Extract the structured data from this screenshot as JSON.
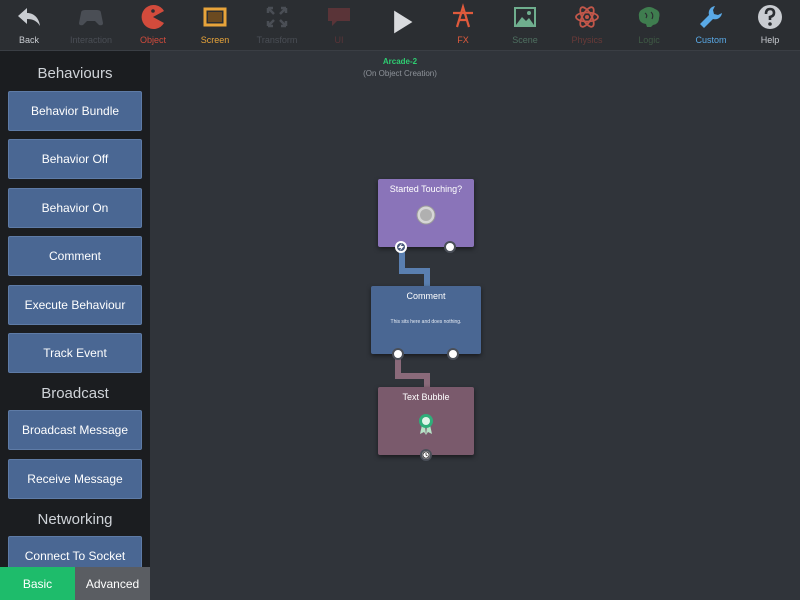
{
  "toolbar": {
    "items": [
      {
        "label": "Back",
        "icon": "back-arrow-icon",
        "color": "#c9ccd1"
      },
      {
        "label": "Interaction",
        "icon": "gamepad-icon",
        "color": "#4a4e55"
      },
      {
        "label": "Object",
        "icon": "pacman-icon",
        "color": "#d24b3c"
      },
      {
        "label": "Screen",
        "icon": "screen-frame-icon",
        "color": "#e8a43a"
      },
      {
        "label": "Transform",
        "icon": "transform-arrows-icon",
        "color": "#4a4e55"
      },
      {
        "label": "UI",
        "icon": "speech-bubble-icon",
        "color": "#5a3438"
      },
      {
        "label": "",
        "icon": "play-icon",
        "color": "#d9dbde"
      },
      {
        "label": "FX",
        "icon": "fx-icon",
        "color": "#e05a3c"
      },
      {
        "label": "Scene",
        "icon": "landscape-image-icon",
        "color": "#6fae8e"
      },
      {
        "label": "Physics",
        "icon": "atom-icon",
        "color": "#c2574a"
      },
      {
        "label": "Logic",
        "icon": "brain-icon",
        "color": "#3f7d4f"
      },
      {
        "label": "Custom",
        "icon": "wrench-icon",
        "color": "#5aa9e6"
      },
      {
        "label": "Help",
        "icon": "question-circle-icon",
        "color": "#c9ccd1"
      }
    ]
  },
  "sidebar": {
    "sections": [
      {
        "title": "Behaviours",
        "buttons": [
          "Behavior Bundle",
          "Behavior Off",
          "Behavior On",
          "Comment",
          "Execute Behaviour",
          "Track Event"
        ]
      },
      {
        "title": "Broadcast",
        "buttons": [
          "Broadcast Message",
          "Receive Message"
        ]
      },
      {
        "title": "Networking",
        "buttons": [
          "Connect To Socket"
        ]
      }
    ],
    "tabs": {
      "basic": "Basic",
      "advanced": "Advanced",
      "active_color": "#1ebc6b",
      "inactive_color": "#5a5d62"
    }
  },
  "canvas": {
    "object_name": "Arcade-2",
    "object_name_color": "#2ecc71",
    "event_label": "(On Object Creation)",
    "nodes": [
      {
        "title": "Started Touching?",
        "color": "#8a74b9",
        "icon": "touch-button-icon"
      },
      {
        "title": "Comment",
        "body": "This sits here and does nothing.",
        "color": "#4a6793"
      },
      {
        "title": "Text Bubble",
        "color": "#7a5a6c",
        "icon": "award-ribbon-icon"
      }
    ],
    "connector_colors": [
      "#5a7fb0",
      "#8a6a7a"
    ]
  }
}
